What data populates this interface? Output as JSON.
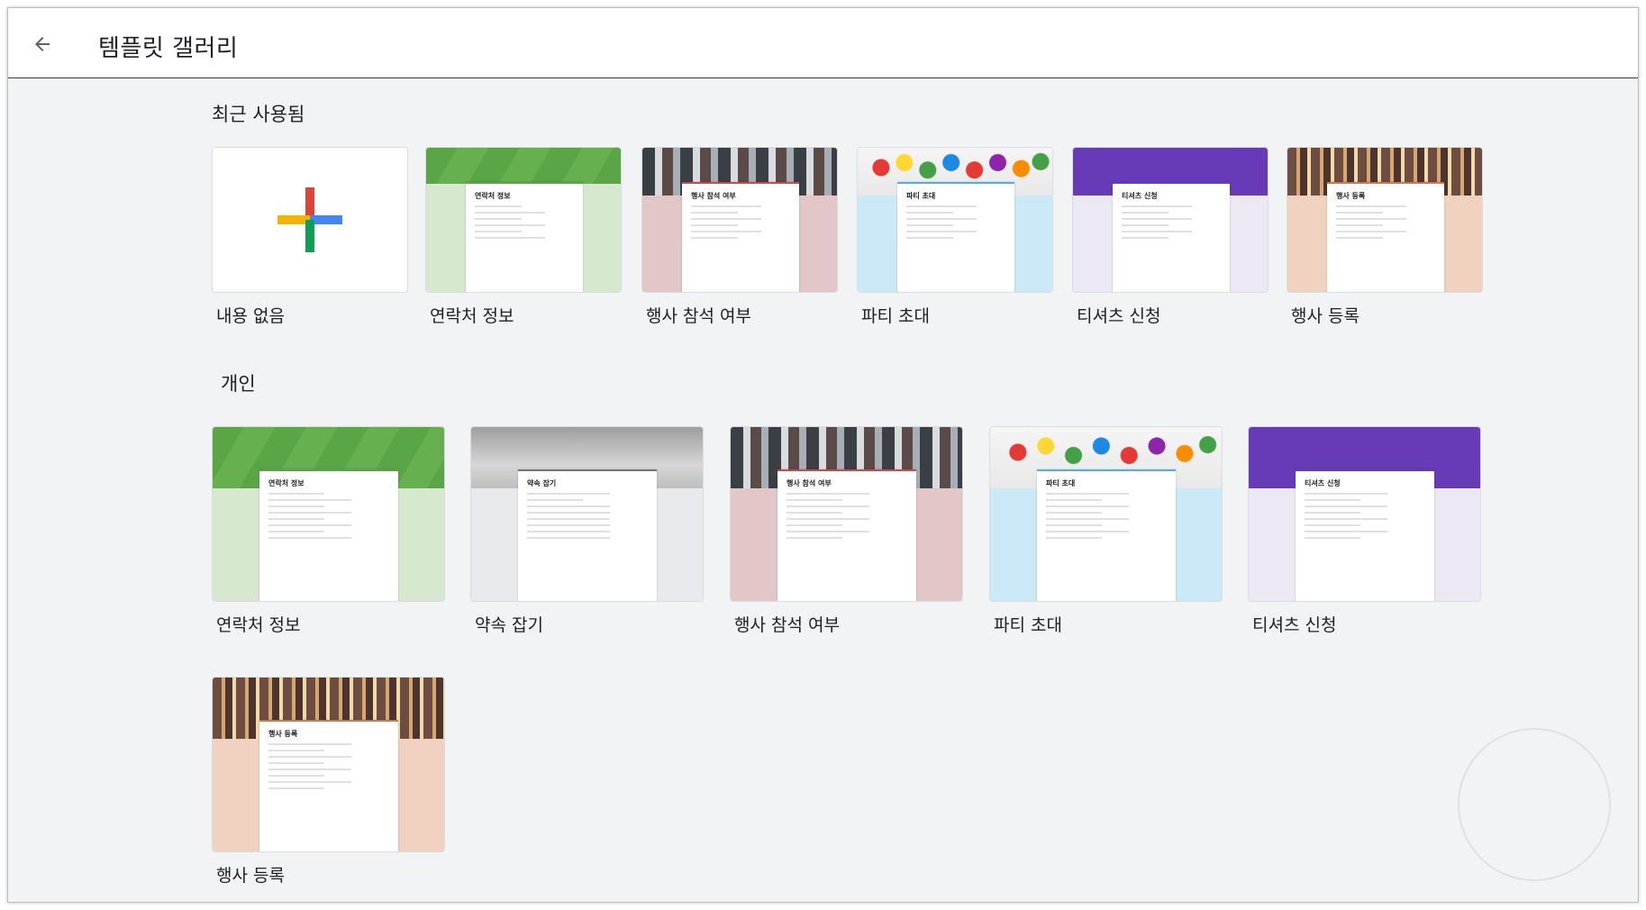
{
  "header": {
    "title": "템플릿 갤러리",
    "back_icon": "arrow-left-icon"
  },
  "sections": {
    "recent": {
      "title": "최근 사용됨",
      "items": [
        {
          "label": "내용 없음",
          "kind": "blank"
        },
        {
          "label": "연락처 정보",
          "kind": "template",
          "sheet_title": "연락처 정보"
        },
        {
          "label": "행사 참석 여부",
          "kind": "template",
          "sheet_title": "행사 참석 여부"
        },
        {
          "label": "파티 초대",
          "kind": "template",
          "sheet_title": "파티 초대"
        },
        {
          "label": "티셔츠 신청",
          "kind": "template",
          "sheet_title": "티셔츠 신청"
        },
        {
          "label": "행사 등록",
          "kind": "template",
          "sheet_title": "행사 등록"
        }
      ]
    },
    "personal": {
      "title": "개인",
      "items": [
        {
          "label": "연락처 정보",
          "sheet_title": "연락처 정보"
        },
        {
          "label": "약속 잡기",
          "sheet_title": "약속 잡기"
        },
        {
          "label": "행사 참석 여부",
          "sheet_title": "행사 참석 여부"
        },
        {
          "label": "파티 초대",
          "sheet_title": "파티 초대"
        },
        {
          "label": "티셔츠 신청",
          "sheet_title": "티셔츠 신청"
        },
        {
          "label": "행사 등록",
          "sheet_title": "행사 등록"
        }
      ]
    }
  },
  "colors": {
    "plus_red": "#db4437",
    "plus_blue": "#4285f4",
    "plus_yellow": "#f4b400",
    "plus_green": "#0f9d58"
  }
}
